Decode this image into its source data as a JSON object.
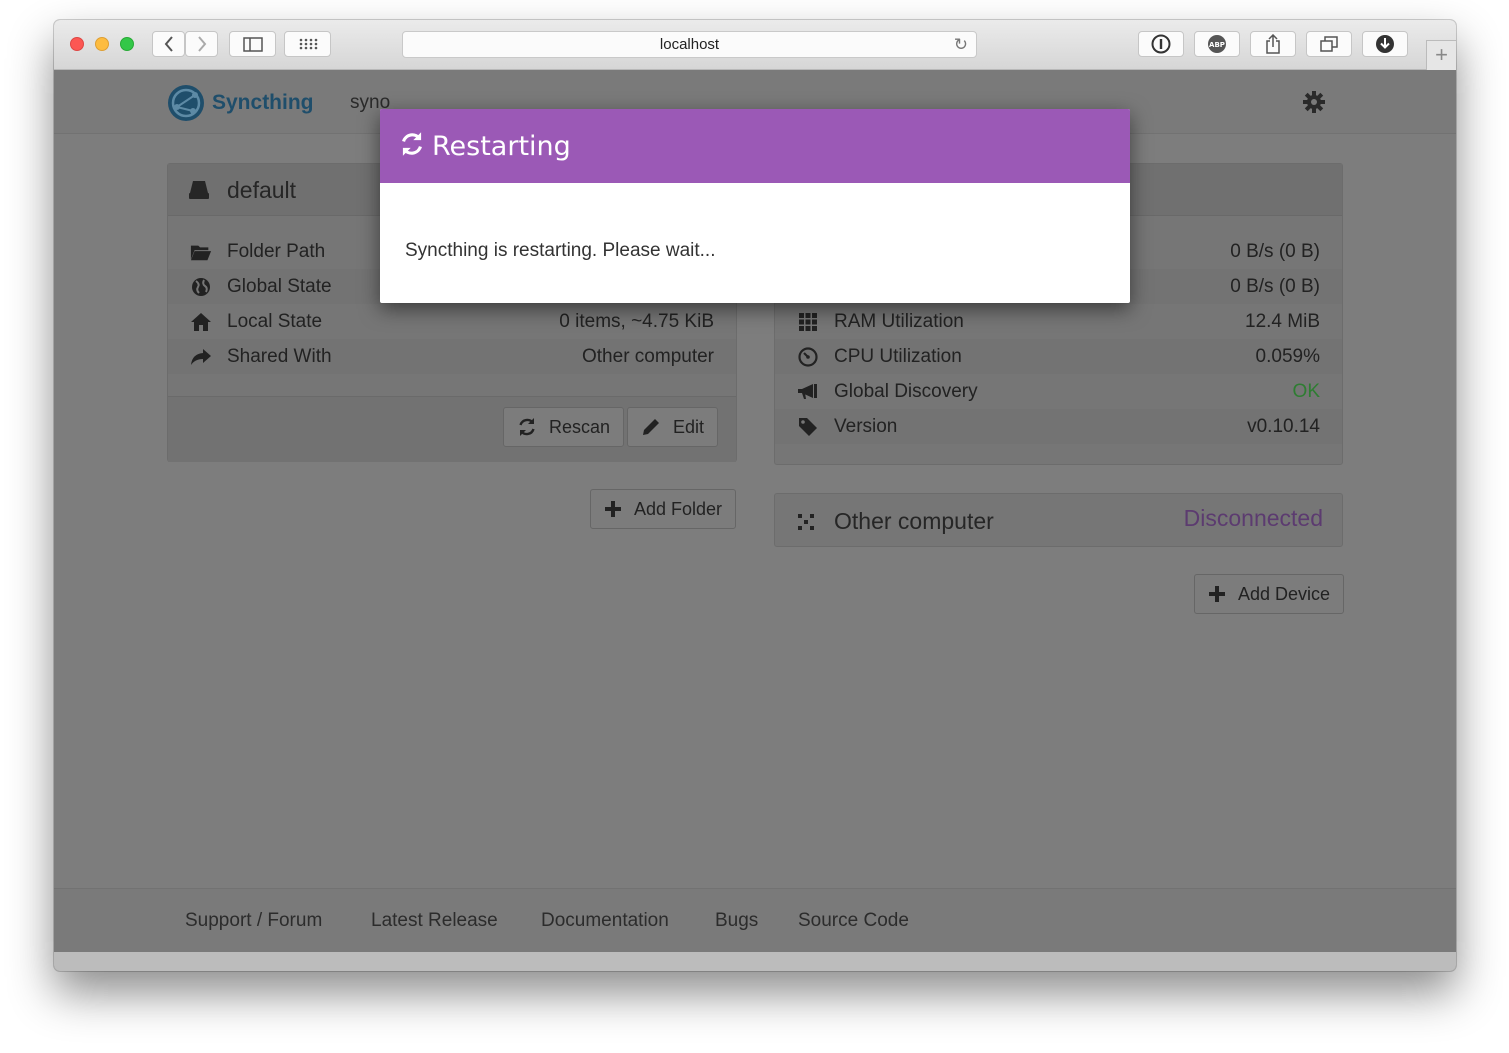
{
  "browser": {
    "url": "localhost"
  },
  "navbar": {
    "brand": "Syncthing",
    "device_name": "syno"
  },
  "folder": {
    "name": "default",
    "rows": [
      {
        "label": "Folder Path",
        "value": "",
        "icon": "folder-open-icon"
      },
      {
        "label": "Global State",
        "value": "",
        "icon": "globe-icon"
      },
      {
        "label": "Local State",
        "value": "0 items, ~4.75 KiB",
        "icon": "home-icon"
      },
      {
        "label": "Shared With",
        "value": "Other computer",
        "icon": "share-icon"
      }
    ],
    "rescan_label": "Rescan",
    "edit_label": "Edit"
  },
  "add_folder_label": "Add Folder",
  "this_device": {
    "rows": [
      {
        "label": "",
        "value": "0 B/s (0 B)",
        "icon": "download-icon"
      },
      {
        "label": "",
        "value": "0 B/s (0 B)",
        "icon": "upload-icon"
      },
      {
        "label": "RAM Utilization",
        "value": "12.4 MiB",
        "icon": "grid-icon"
      },
      {
        "label": "CPU Utilization",
        "value": "0.059%",
        "icon": "dashboard-icon"
      },
      {
        "label": "Global Discovery",
        "value": "OK",
        "icon": "bullhorn-icon",
        "value_color": "#2e7d32"
      },
      {
        "label": "Version",
        "value": "v0.10.14",
        "icon": "tag-icon"
      }
    ]
  },
  "remote_device": {
    "name": "Other computer",
    "status": "Disconnected",
    "status_color": "#5c3b70"
  },
  "add_device_label": "Add Device",
  "footer": {
    "links": [
      "Support / Forum",
      "Latest Release",
      "Documentation",
      "Bugs",
      "Source Code"
    ]
  },
  "modal": {
    "title": "Restarting",
    "message": "Syncthing is restarting. Please wait...",
    "header_color": "#9b59b6"
  }
}
